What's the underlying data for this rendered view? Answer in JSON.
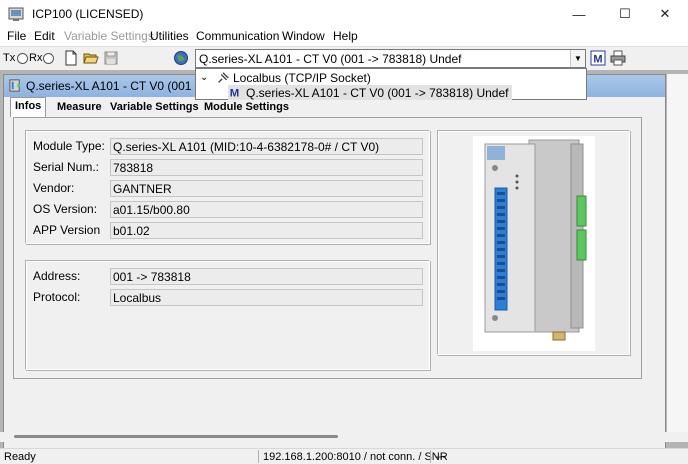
{
  "window": {
    "title": "ICP100   (LICENSED)",
    "minimize_glyph": "—",
    "maximize_glyph": "☐",
    "close_glyph": "✕"
  },
  "menu": [
    "File",
    "Edit",
    "Variable Settings",
    "Utilities",
    "Communication",
    "Window",
    "Help"
  ],
  "toolbar": {
    "tx_label": "Tx",
    "rx_label": "Rx",
    "module_select_value": "Q.series-XL A101 - CT V0 (001 -> 783818) Undef",
    "icons": [
      "new-file-icon",
      "open-folder-icon",
      "save-icon",
      "globe-icon",
      "module-m-icon",
      "printer-icon"
    ]
  },
  "dropdown": {
    "items": [
      {
        "label": "Localbus (TCP/IP Socket)",
        "icon": "plug-icon"
      },
      {
        "label": "Q.series-XL A101 - CT V0 (001 -> 783818) Undef",
        "icon": "module-m-icon",
        "selected": true
      }
    ],
    "tree_toggle": "⌄"
  },
  "child_window": {
    "title": "Q.series-XL A101 - CT V0 (001 -> 783",
    "tabs": [
      "Infos",
      "Measure",
      "Variable Settings",
      "Module Settings"
    ],
    "active_tab": "Infos"
  },
  "info": {
    "module_group": [
      {
        "label": "Module Type:",
        "value": "Q.series-XL A101 (MID:10-4-6382178-0# / CT V0)"
      },
      {
        "label": "Serial Num.:",
        "value": "783818"
      },
      {
        "label": "Vendor:",
        "value": "GANTNER"
      },
      {
        "label": "OS Version:",
        "value": "a01.15/b00.80"
      },
      {
        "label": "APP Version",
        "value": "b01.02"
      }
    ],
    "address_group": [
      {
        "label": "Address:",
        "value": "001 -> 783818"
      },
      {
        "label": "Protocol:",
        "value": "Localbus"
      }
    ]
  },
  "status": {
    "state": "Ready",
    "connection": "192.168.1.200:8010 / not conn. / SNR",
    "extra": "---"
  },
  "colors": {
    "child_title": "#8fb3de",
    "workspace": "#b4b4b4",
    "module_body": "#d9d9d9",
    "module_terminals": "#2d7fd6",
    "module_connectors": "#5cc75c"
  }
}
